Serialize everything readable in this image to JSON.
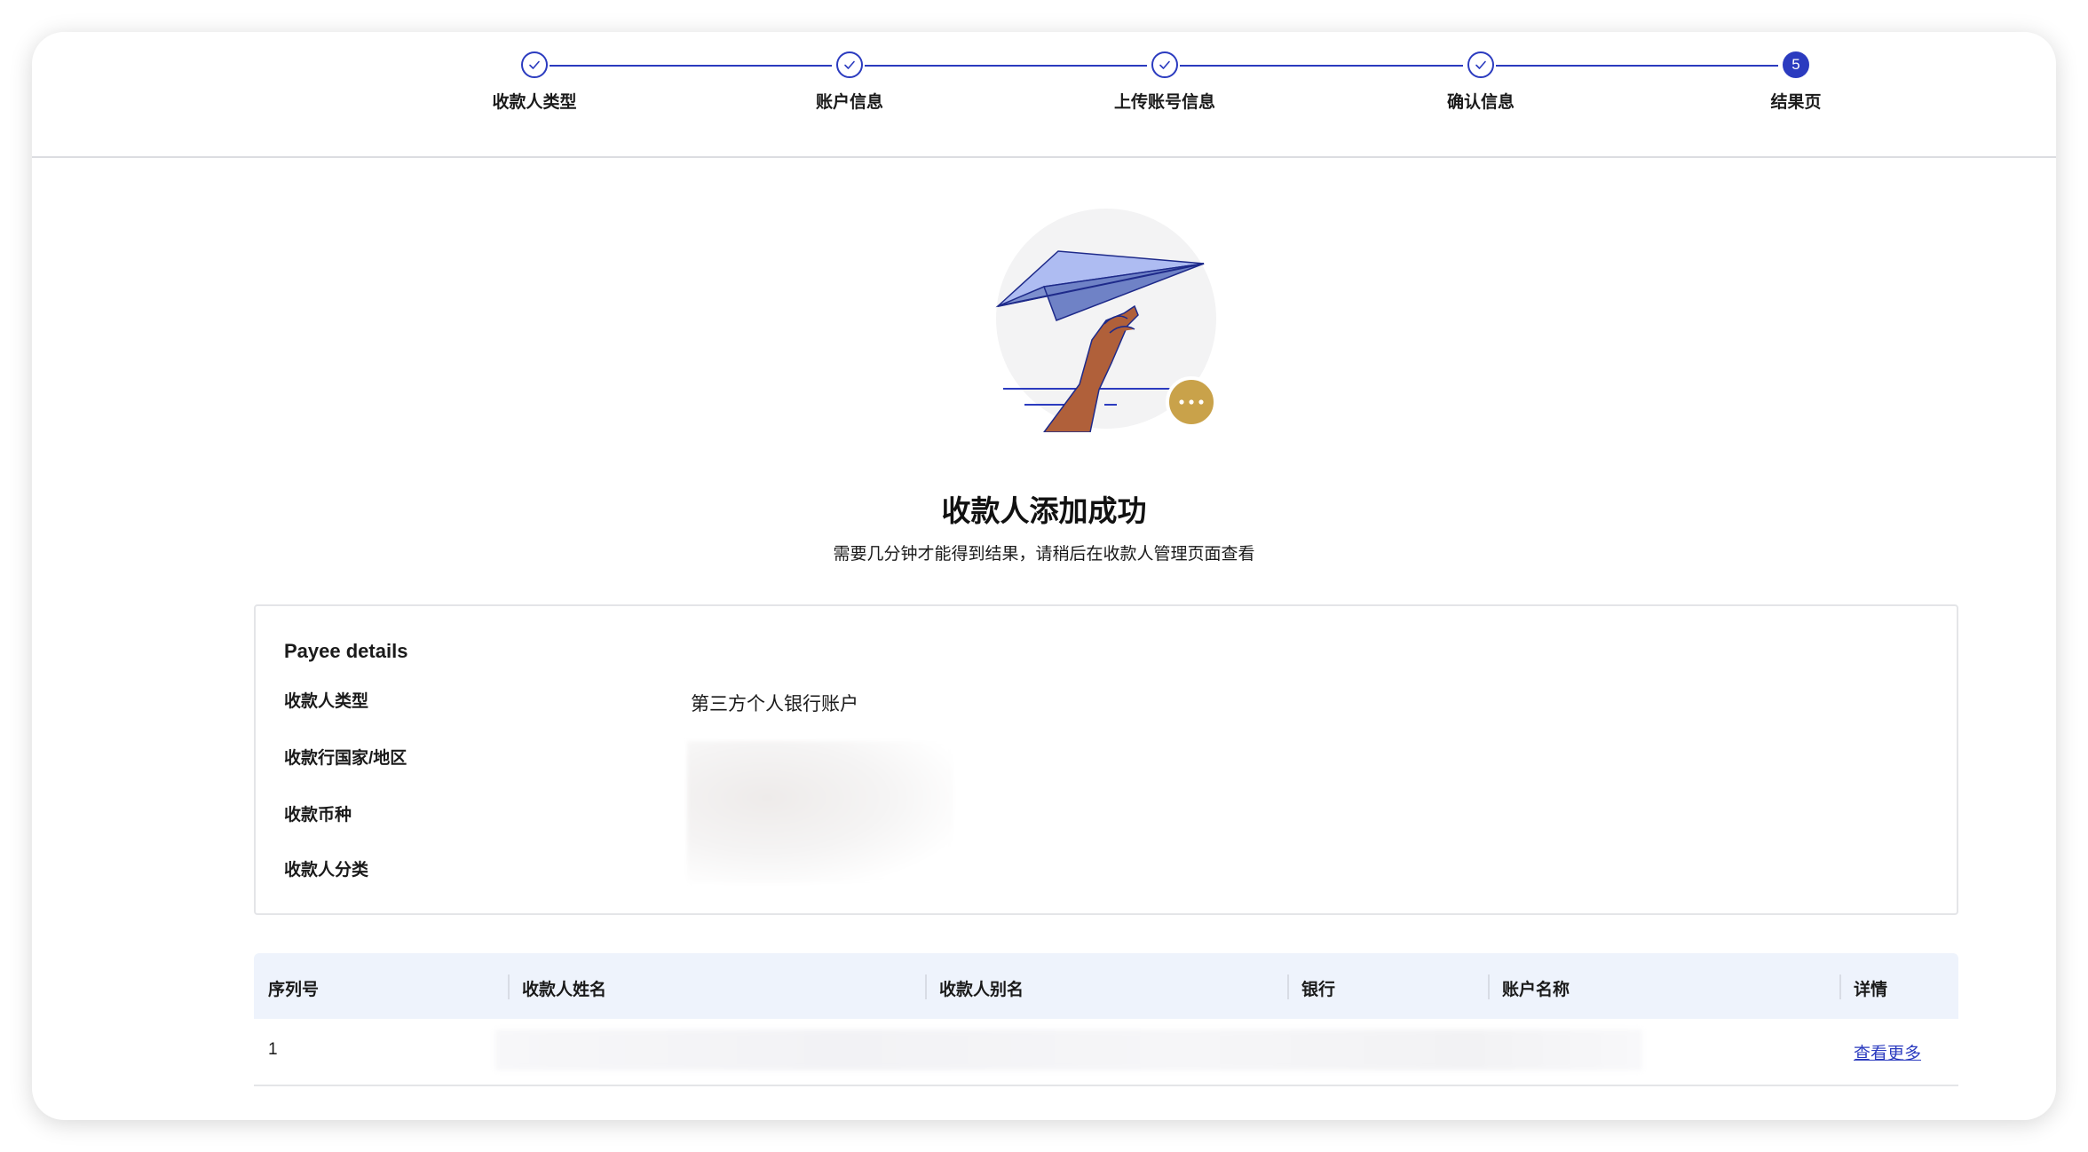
{
  "stepper": {
    "steps": [
      {
        "label": "收款人类型",
        "state": "done"
      },
      {
        "label": "账户信息",
        "state": "done"
      },
      {
        "label": "上传账号信息",
        "state": "done"
      },
      {
        "label": "确认信息",
        "state": "done"
      },
      {
        "label": "结果页",
        "state": "active",
        "number": "5"
      }
    ]
  },
  "result": {
    "illustration": "paper-plane-hand",
    "badge_icon": "more-dots-icon",
    "title": "收款人添加成功",
    "subtitle": "需要几分钟才能得到结果，请稍后在收款人管理页面查看"
  },
  "details": {
    "title": "Payee details",
    "rows": [
      {
        "label": "收款人类型",
        "value": "第三方个人银行账户"
      },
      {
        "label": "收款行国家/地区"
      },
      {
        "label": "收款币种"
      },
      {
        "label": "收款人分类"
      }
    ]
  },
  "table": {
    "headers": [
      "序列号",
      "收款人姓名",
      "收款人别名",
      "银行",
      "账户名称",
      "详情"
    ],
    "rows": [
      {
        "index": "1",
        "action": "查看更多"
      }
    ]
  },
  "colors": {
    "primary": "#2b3bbf",
    "badge": "#c9a24a",
    "table_header_bg": "#eef3fc"
  }
}
